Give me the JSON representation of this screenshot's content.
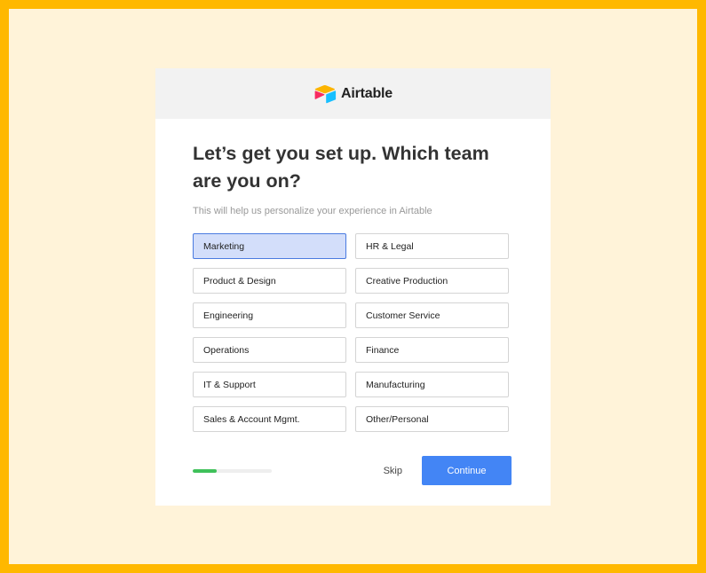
{
  "brand": {
    "name": "Airtable",
    "colors": {
      "yellow": "#FCB400",
      "blue": "#2D7FF9",
      "red": "#F82B60",
      "cyan": "#18BFFF"
    }
  },
  "page": {
    "title": "Let’s get you set up. Which team are you on?",
    "subtitle": "This will help us personalize your experience in Airtable"
  },
  "options": [
    {
      "label": "Marketing",
      "selected": true
    },
    {
      "label": "HR & Legal",
      "selected": false
    },
    {
      "label": "Product & Design",
      "selected": false
    },
    {
      "label": "Creative Production",
      "selected": false
    },
    {
      "label": "Engineering",
      "selected": false
    },
    {
      "label": "Customer Service",
      "selected": false
    },
    {
      "label": "Operations",
      "selected": false
    },
    {
      "label": "Finance",
      "selected": false
    },
    {
      "label": "IT & Support",
      "selected": false
    },
    {
      "label": "Manufacturing",
      "selected": false
    },
    {
      "label": "Sales & Account Mgmt.",
      "selected": false
    },
    {
      "label": "Other/Personal",
      "selected": false
    }
  ],
  "progress": {
    "fraction": 0.3,
    "color": "#3FC15A"
  },
  "actions": {
    "skip_label": "Skip",
    "continue_label": "Continue",
    "continue_color": "#4385F5"
  },
  "icons": {
    "logo": "airtable-logo-icon"
  }
}
